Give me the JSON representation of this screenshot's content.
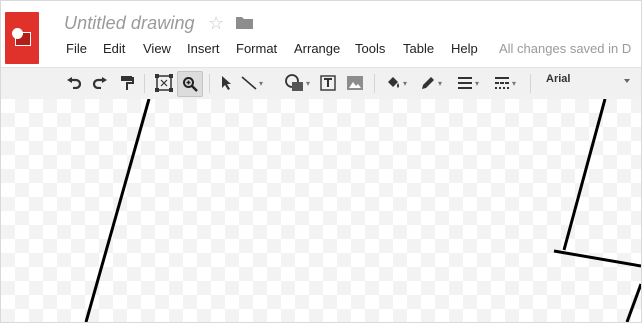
{
  "document": {
    "title": "Untitled drawing",
    "star_icon": "star-outline-icon",
    "folder_icon": "folder-icon",
    "save_status": "All changes saved in D"
  },
  "menu": [
    "File",
    "Edit",
    "View",
    "Insert",
    "Format",
    "Arrange",
    "Tools",
    "Table",
    "Help"
  ],
  "toolbar": {
    "buttons": [
      "undo-icon",
      "redo-icon",
      "paint-format-icon",
      "zoom-fit-icon",
      "zoom-icon",
      "select-arrow-icon",
      "line-icon",
      "shape-icon",
      "text-box-icon",
      "image-icon",
      "fill-color-icon",
      "line-color-icon",
      "line-weight-icon",
      "line-dash-icon"
    ],
    "font": "Arial"
  },
  "colors": {
    "brand_red": "#e0322a",
    "toolbar_bg": "#f1f1f1",
    "muted_text": "#9a9a9a"
  }
}
